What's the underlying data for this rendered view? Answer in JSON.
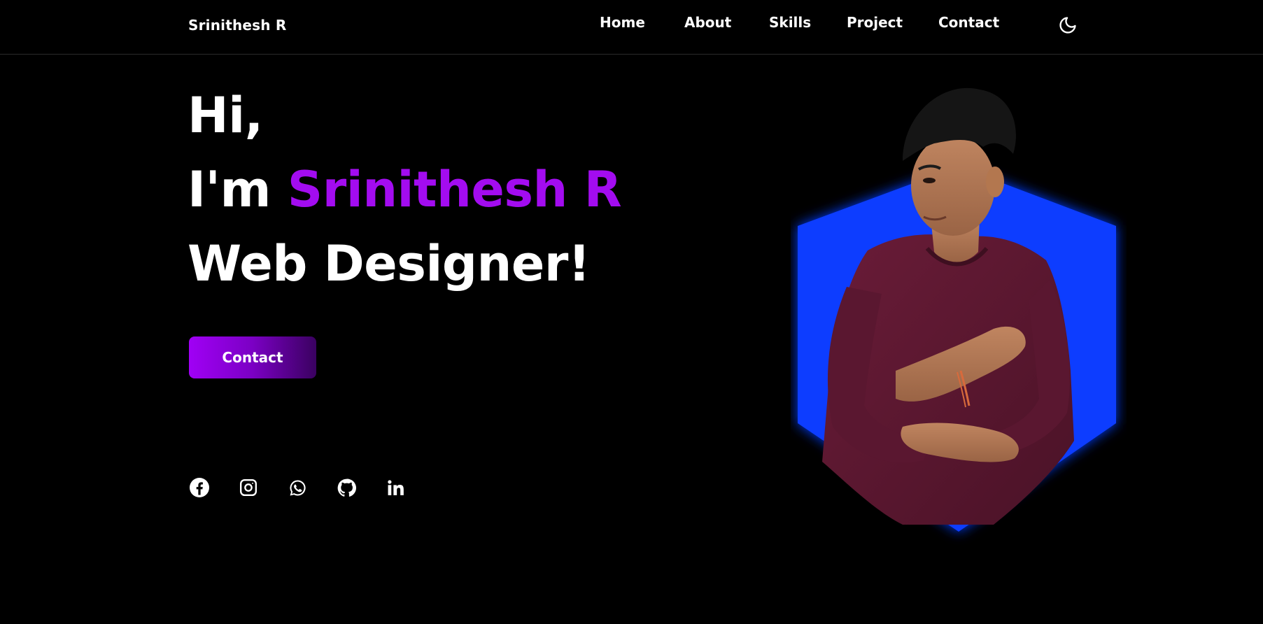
{
  "header": {
    "logo": "Srinithesh R",
    "nav": {
      "home": "Home",
      "about": "About",
      "skills": "Skills",
      "project": "Project",
      "contact": "Contact"
    },
    "theme_icon": "moon-icon"
  },
  "hero": {
    "greeting": "Hi,",
    "intro_prefix": "I'm",
    "name": "Srinithesh R",
    "role": "Web Designer!",
    "cta_label": "Contact"
  },
  "socials": [
    {
      "icon": "facebook-icon"
    },
    {
      "icon": "instagram-icon"
    },
    {
      "icon": "whatsapp-icon"
    },
    {
      "icon": "github-icon"
    },
    {
      "icon": "linkedin-icon"
    }
  ],
  "colors": {
    "background": "#000000",
    "accent": "#a30cf0",
    "hexagon": "#0a3cff",
    "shirt": "#5a1830"
  }
}
